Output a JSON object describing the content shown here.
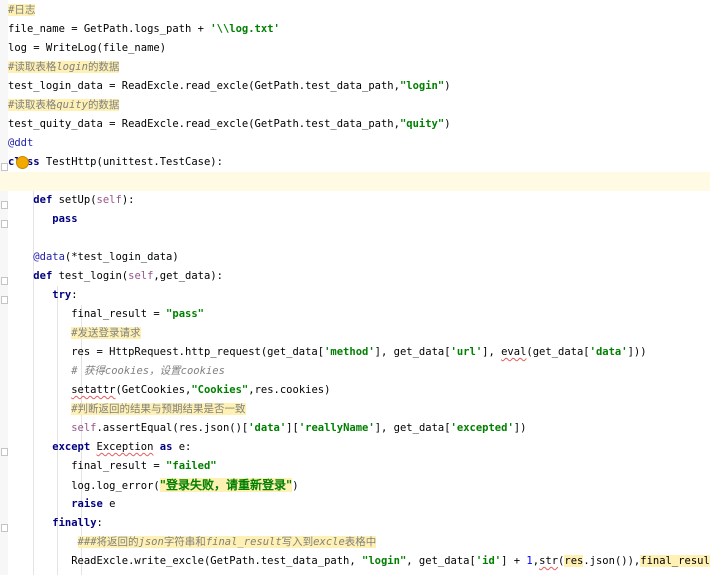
{
  "code": {
    "line1_comment": "#日志",
    "line2_a": "file_name = GetPath.logs_path + ",
    "line2_str": "'\\\\log.txt'",
    "line3": "log = WriteLog(file_name)",
    "line4_a": "#读取表格",
    "line4_b": "login",
    "line4_c": "的数据",
    "line5_a": "test_login_data = ReadExcle.read_excle(GetPath.test_data_path,",
    "line5_str": "\"login\"",
    "line5_b": ")",
    "line6_a": "#读取表格",
    "line6_b": "quity",
    "line6_c": "的数据",
    "line7_a": "test_quity_data = ReadExcle.read_excle(GetPath.test_data_path,",
    "line7_str": "\"quity\"",
    "line7_b": ")",
    "line8_deco": "@ddt",
    "line9_kw": "class",
    "line9_b": " TestHttp(unittest.TestCase):",
    "line11_kw": "def",
    "line11_b": " setUp(",
    "line11_self": "self",
    "line11_c": "):",
    "line12_kw": "pass",
    "line14_deco": "@data",
    "line14_b": "(*test_login_data)",
    "line15_kw": "def",
    "line15_b": " test_login(",
    "line15_self": "self",
    "line15_c": ",get_data):",
    "line16_kw": "try",
    "line16_b": ":",
    "line17_a": "final_result = ",
    "line17_str": "\"pass\"",
    "line18_comment": "#发送登录请求",
    "line19_a": "res = HttpRequest.http_request(get_data[",
    "line19_s1": "'method'",
    "line19_b": "], get_data[",
    "line19_s2": "'url'",
    "line19_c": "], ",
    "line19_eval": "eval",
    "line19_d": "(get_data[",
    "line19_s3": "'data'",
    "line19_e": "]))",
    "line20_a": "# 获得",
    "line20_b": "cookies",
    "line20_c": "，设置",
    "line20_d": "cookies",
    "line21_a": "setattr",
    "line21_b": "(GetCookies,",
    "line21_str": "\"Cookies\"",
    "line21_c": ",res.cookies)",
    "line22_comment": "#判断返回的结果与预期结果是否一致",
    "line23_self": "self",
    "line23_a": ".assertEqual(res.json()[",
    "line23_s1": "'data'",
    "line23_b": "][",
    "line23_s2": "'reallyName'",
    "line23_c": "], get_data[",
    "line23_s3": "'excepted'",
    "line23_d": "])",
    "line24_kw": "except",
    "line24_a": " ",
    "line24_exc": "Exception",
    "line24_kw2": " as",
    "line24_b": " e:",
    "line25_a": "final_result = ",
    "line25_str": "\"failed\"",
    "line26_a": "log.log_error(",
    "line26_str": "\"登录失败，请重新登录\"",
    "line26_b": ")",
    "line27_kw": "raise",
    "line27_b": " e",
    "line28_kw": "finally",
    "line28_b": ":",
    "line29_a": "###将返回的",
    "line29_b": "json",
    "line29_c": "字符串和",
    "line29_d": "final_result",
    "line29_e": "写入到",
    "line29_f": "excle",
    "line29_g": "表格中",
    "line30_a": "ReadExcle.write_excle(GetPath.test_data_path, ",
    "line30_str": "\"login\"",
    "line30_b": ", get_data[",
    "line30_s1": "'id'",
    "line30_c": "] + ",
    "line30_num": "1",
    "line30_d": ",",
    "line30_str2": "str",
    "line30_e": "(",
    "line30_res": "res",
    "line30_f": ".json()),",
    "line30_fr": "final_result",
    "line30_g": ")"
  },
  "colors": {
    "comment": "#808080",
    "string": "#008000",
    "keyword": "#000080",
    "self": "#94558d",
    "highlight": "#fff1b3",
    "caret_line": "#fffae3"
  },
  "icons": {
    "intention_bulb": "lightbulb-icon",
    "fold_marker": "fold-icon"
  }
}
